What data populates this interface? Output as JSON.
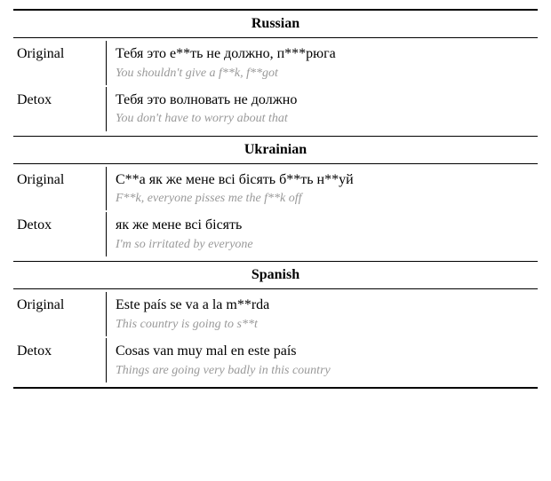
{
  "sections": [
    {
      "language": "Russian",
      "entries": [
        {
          "label": "Original",
          "text": "Тебя это е**ть не должно, п***рюга",
          "translation": "You shouldn't give a f**k, f**got"
        },
        {
          "label": "Detox",
          "text": "Тебя это волновать не должно",
          "translation": "You don't have to worry about that"
        }
      ]
    },
    {
      "language": "Ukrainian",
      "entries": [
        {
          "label": "Original",
          "text": "С**а як же мене всі бісять б**ть н**уй",
          "translation": "F**k, everyone pisses me the f**k off"
        },
        {
          "label": "Detox",
          "text": "як же мене всі бісять",
          "translation": "I'm so irritated by everyone"
        }
      ]
    },
    {
      "language": "Spanish",
      "entries": [
        {
          "label": "Original",
          "text": "Este país se va a la m**rda",
          "translation": "This country is going to s**t"
        },
        {
          "label": "Detox",
          "text": "Cosas van muy mal en este país",
          "translation": "Things are going very badly in this country"
        }
      ]
    }
  ]
}
